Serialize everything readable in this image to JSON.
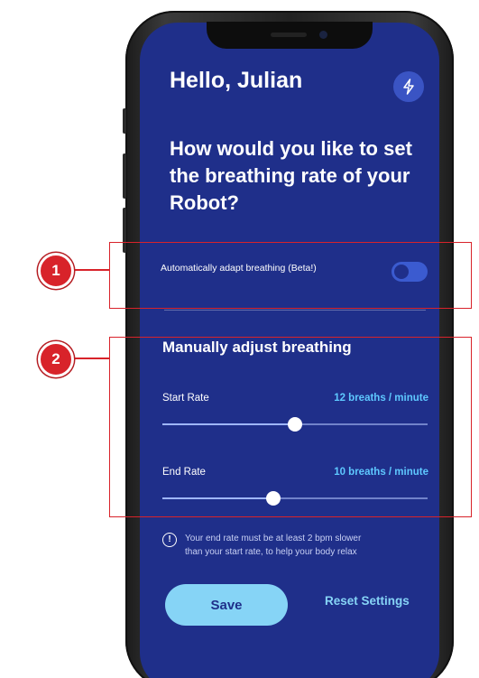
{
  "header": {
    "greeting": "Hello, Julian",
    "shortcut_icon": "bolt-icon"
  },
  "question": "How would you like to set the breathing rate of your Robot?",
  "auto_adapt": {
    "label": "Automatically adapt breathing (Beta!)",
    "enabled": false
  },
  "manual": {
    "title": "Manually adjust breathing",
    "start_rate": {
      "label": "Start Rate",
      "value_text": "12  breaths / minute",
      "level_percent": 50
    },
    "end_rate": {
      "label": "End Rate",
      "value_text": "10 breaths / minute",
      "level_percent": 42
    }
  },
  "info": {
    "icon": "info-icon",
    "line1": "Your end rate must be at least 2 bpm slower",
    "line2": "than your start rate, to help your body relax"
  },
  "actions": {
    "save_label": "Save",
    "reset_label": "Reset Settings"
  },
  "annotations": {
    "marker1": "1",
    "marker2": "2"
  },
  "colors": {
    "screen_bg": "#1f2f8a",
    "accent": "#86d4f6",
    "rate_value": "#5ec8ff",
    "annotation": "#d8232a"
  }
}
